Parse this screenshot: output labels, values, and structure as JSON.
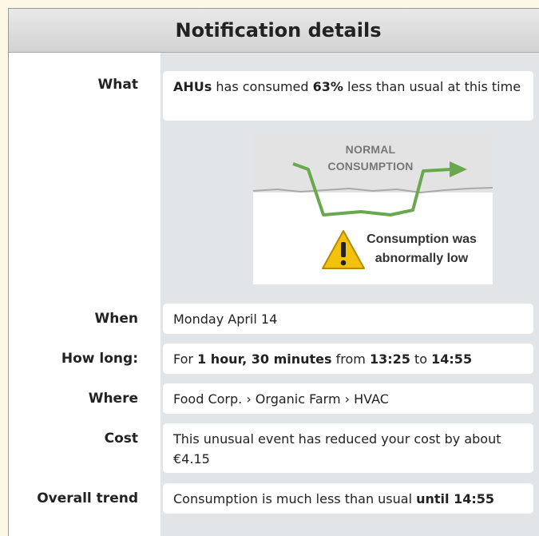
{
  "header": {
    "title": "Notification details"
  },
  "rows": {
    "what": {
      "label": "What",
      "subject": "AHUs",
      "text1": " has consumed ",
      "percent": "63%",
      "text2": " less than usual at this time"
    },
    "illustration": {
      "normal_line1": "NORMAL",
      "normal_line2": "CONSUMPTION",
      "warning_line1": "Consumption was",
      "warning_line2": "abnormally low",
      "colors": {
        "trend": "#6aa84f",
        "baseline": "#aaaaaa",
        "warning": "#f4c20d"
      },
      "icons": [
        "arrow-right-icon",
        "warning-icon"
      ]
    },
    "when": {
      "label": "When",
      "value": "Monday April 14"
    },
    "how_long": {
      "label": "How long:",
      "prefix": "For ",
      "duration": "1 hour, 30 minutes",
      "from_text": " from ",
      "start": "13:25",
      "to_text": " to ",
      "end": "14:55"
    },
    "where": {
      "label": "Where",
      "value": "Food Corp. › Organic Farm › HVAC"
    },
    "cost": {
      "label": "Cost",
      "value": "This unusual event has reduced your cost by about €4.15"
    },
    "trend": {
      "label": "Overall trend",
      "text": "Consumption is much less than usual ",
      "until": "until 14:55"
    }
  }
}
